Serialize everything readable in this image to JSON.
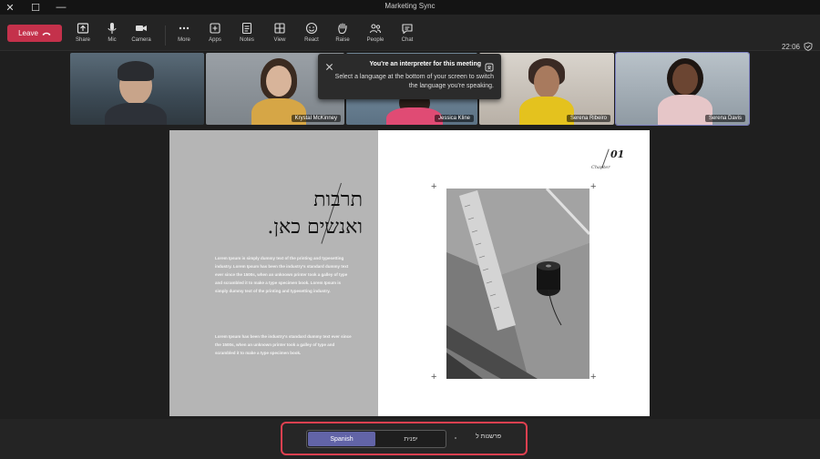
{
  "window": {
    "title": "Marketing Sync",
    "controls": [
      "✕",
      "☐",
      "—"
    ]
  },
  "toolbar": {
    "leave_label": "Leave",
    "clock": "22:06",
    "buttons": [
      {
        "key": "share",
        "label": "Share",
        "icon": "share-icon"
      },
      {
        "key": "mic",
        "label": "Mic",
        "icon": "mic-icon"
      },
      {
        "key": "camera",
        "label": "Camera",
        "icon": "camera-icon"
      },
      {
        "key": "more",
        "label": "More",
        "icon": "more-icon"
      },
      {
        "key": "apps",
        "label": "Apps",
        "icon": "apps-icon"
      },
      {
        "key": "notes",
        "label": "Notes",
        "icon": "notes-icon"
      },
      {
        "key": "view",
        "label": "View",
        "icon": "view-icon"
      },
      {
        "key": "react",
        "label": "React",
        "icon": "react-icon"
      },
      {
        "key": "raise",
        "label": "Raise",
        "icon": "raise-hand-icon"
      },
      {
        "key": "people",
        "label": "People",
        "icon": "people-icon"
      },
      {
        "key": "chat",
        "label": "Chat",
        "icon": "chat-icon"
      }
    ]
  },
  "participants": [
    {
      "name": ""
    },
    {
      "name": "Krystal McKinney"
    },
    {
      "name": "Jessica Kline"
    },
    {
      "name": "Serena Ribeiro"
    },
    {
      "name": "Serena Davis"
    }
  ],
  "toast": {
    "title": "You're an interpreter for this meeting",
    "body": "Select a language at the bottom of your screen to switch the language you're speaking."
  },
  "slide": {
    "title_line1": "תרבות",
    "title_line2": "ואנשים כאן.",
    "paragraph1": "Lorem Ipsum is simply dummy text of the printing and typesetting industry. Lorem Ipsum has been the industry's standard dummy text ever since the 1500s, when an unknown printer took a galley of type and scrambled it to make a type specimen book. Lorem Ipsum is simply dummy text of the printing and typesetting industry.",
    "paragraph2": "Lorem Ipsum has been the industry's standard dummy text ever since the 1500s, when an unknown printer took a galley of type and scrambled it to make a type specimen book.",
    "chapter_number": "01",
    "chapter_label": "Chapter"
  },
  "language_bar": {
    "selected": "Spanish",
    "other": "יפנית",
    "label": "פרשנות ל"
  },
  "colors": {
    "leave": "#c4314b",
    "accent": "#6264a7",
    "highlight": "#e04050"
  }
}
